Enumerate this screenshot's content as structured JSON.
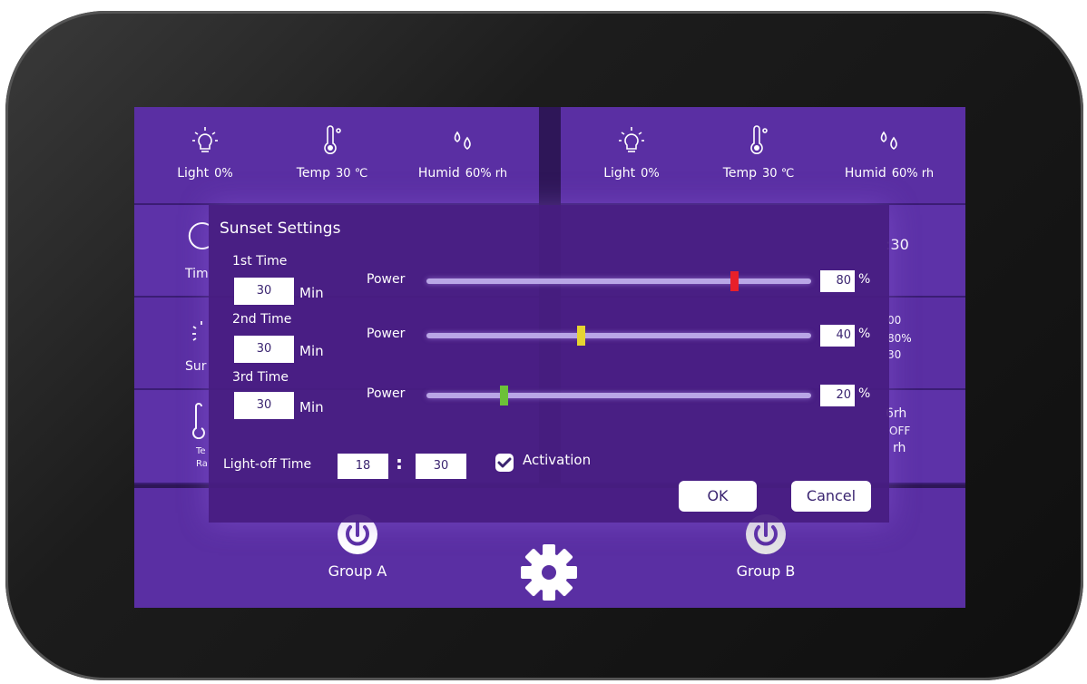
{
  "left_sensors": [
    {
      "icon": "bulb-icon",
      "label": "Light",
      "value": "0%"
    },
    {
      "icon": "thermometer-icon",
      "label": "Temp",
      "value": "30 ℃"
    },
    {
      "icon": "droplets-icon",
      "label": "Humid",
      "value": "60% rh"
    }
  ],
  "right_sensors": [
    {
      "icon": "bulb-icon",
      "label": "Light",
      "value": "0%"
    },
    {
      "icon": "thermometer-icon",
      "label": "Temp",
      "value": "30 ℃"
    },
    {
      "icon": "droplets-icon",
      "label": "Humid",
      "value": "60% rh"
    }
  ],
  "left_rows": {
    "row2_label": "Tim",
    "row3_label": "Sur",
    "row4_label_a": "Te",
    "row4_label_b": "Ra"
  },
  "right_rows": {
    "row2_text": ":30",
    "row3_text_a": "00",
    "row3_text_b": "80%",
    "row3_text_c": "30",
    "row4_text_a": "6rh",
    "row4_text_b": "OFF",
    "row4_text_c": "rh"
  },
  "bottom": {
    "group_a": "Group A",
    "group_b": "Group B"
  },
  "dialog": {
    "title": "Sunset Settings",
    "entries": [
      {
        "time_label": "1st  Time",
        "minutes": "30",
        "min_unit": "Min",
        "power_label": "Power",
        "power": "80",
        "power_fraction": 0.8,
        "thumb_color": "#e8202a",
        "pct_unit": "%"
      },
      {
        "time_label": "2nd  Time",
        "minutes": "30",
        "min_unit": "Min",
        "power_label": "Power",
        "power": "40",
        "power_fraction": 0.4,
        "thumb_color": "#e6d431",
        "pct_unit": "%"
      },
      {
        "time_label": "3rd  Time",
        "minutes": "30",
        "min_unit": "Min",
        "power_label": "Power",
        "power": "20",
        "power_fraction": 0.2,
        "thumb_color": "#6cc138",
        "pct_unit": "%"
      }
    ],
    "lightoff_label": "Light-off Time",
    "lightoff_hour": "18",
    "lightoff_colon": ":",
    "lightoff_minute": "30",
    "activation_label": "Activation",
    "activation_checked": true,
    "ok_label": "OK",
    "cancel_label": "Cancel"
  },
  "colors": {
    "screen_bg": "#2e1658",
    "panel_bg": "#5a2fa3",
    "dialog_bg": "#481e82",
    "text": "#ffffff"
  }
}
